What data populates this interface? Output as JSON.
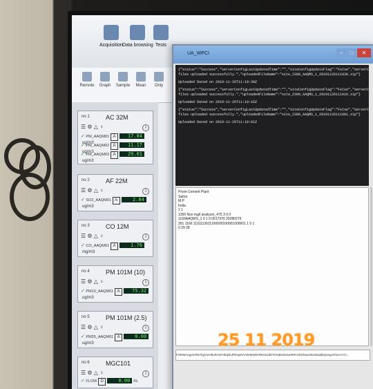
{
  "toolbar": {
    "buttons": [
      "Acquisition",
      "Data browsing",
      "Tests"
    ]
  },
  "subbar": {
    "buttons": [
      "Remote",
      "Graph",
      "Sample",
      "Mean",
      "Only"
    ]
  },
  "cards": [
    {
      "num": "no 1",
      "title": "AC 32M",
      "rows": [
        {
          "label": "PM_AAQM01",
          "value": "17.84",
          "unit": "ug/m3",
          "badge": "A"
        },
        {
          "label": "PM_AAQM02",
          "value": "11.17",
          "unit": "ug/m3",
          "badge": "A"
        },
        {
          "label": "PM_AAQM03",
          "value": "29.01",
          "unit": "ug/m3",
          "badge": "A"
        }
      ]
    },
    {
      "num": "no 2",
      "title": "AF 22M",
      "rows": [
        {
          "label": "SO2_AAQM01",
          "value": "2.84",
          "unit": "ug/m3",
          "badge": "A"
        }
      ]
    },
    {
      "num": "no 3",
      "title": "CO 12M",
      "rows": [
        {
          "label": "CO_AAQM01",
          "value": "1.76",
          "unit": "mg/m3",
          "badge": "A"
        }
      ]
    },
    {
      "num": "no 4",
      "title": "PM 101M (10)",
      "rows": [
        {
          "label": "PM10_AAQM01",
          "value": "75.32",
          "unit": "ug/m3",
          "badge": "A"
        }
      ]
    },
    {
      "num": "no 5",
      "title": "PM 101M (2.5)",
      "rows": [
        {
          "label": "PM25_AAQM01",
          "value": "0.00",
          "unit": "ug/m3",
          "badge": "A"
        }
      ]
    },
    {
      "num": "no 6",
      "title": "MGC101",
      "rows": [
        {
          "label": "FLOW",
          "value": "0.00",
          "unit": "l/s",
          "badge": "D"
        }
      ]
    }
  ],
  "window": {
    "title": "UA_WPCI",
    "min": "–",
    "max": "□",
    "close": "✕"
  },
  "console": [
    "{\"status\":\"Success\",\"serverConfigLastUpdatedTime\":\"\",\"siteConfigUpdateFlag\":\"False\",\"serverCalibrationLastUpdatedTime\":\"\",\"statusMessage\":\"1 files uploaded successfully.\",\"uploadedFileName\":\"site_2308_AAQMS_1_20191126111030.zip\"}",
    "Uploaded  Dated on 2019-11-26T11:10:30Z",
    "{\"status\":\"Success\",\"serverConfigLastUpdatedTime\":\"\",\"siteConfigUpdateFlag\":\"False\",\"serverCalibrationLastUpdatedTime\":\"\",\"statusMessage\":\"1 files uploaded successfully.\",\"uploadedFileName\":\"site_2308_AAQMS_1_20191126111016.zip\"}",
    "Uploaded  Dated on 2019-11-26T11:10:16Z",
    "{\"status\":\"Success\",\"serverConfigLastUpdatedTime\":\"\",\"siteConfigUpdateFlag\":\"False\",\"serverCalibrationLastUpdatedTime\":\"\",\"statusMessage\":\"1 files uploaded successfully.\",\"uploadedFileName\":\"site_2308_AAQMS_1_20191126111001.zip\"}",
    "Uploaded  Dated on 2019-11-26T11:10:01Z"
  ],
  "log": [
    "Prism Cement Plant",
    "Satna",
    "M.P",
    "India",
    "1    1",
    "1350 Nox          mg/l     analyzer_475     3     0     0",
    "1156AAQMS_1        0 1 0 0517976 29280279",
    "351 1166    1191112611100000100001000001  1  0  1",
    "0 29 28"
  ],
  "footer": "FORMAeg2iVR67bgVvIHbuR1WYtb/pibJPbzp8VVvfeM3dtVR6OUd0FiOSdMJ5mw/t5FnrSDhwwOk445uBlepsngAF5vAA7C...",
  "stamp": "25 11 2019"
}
